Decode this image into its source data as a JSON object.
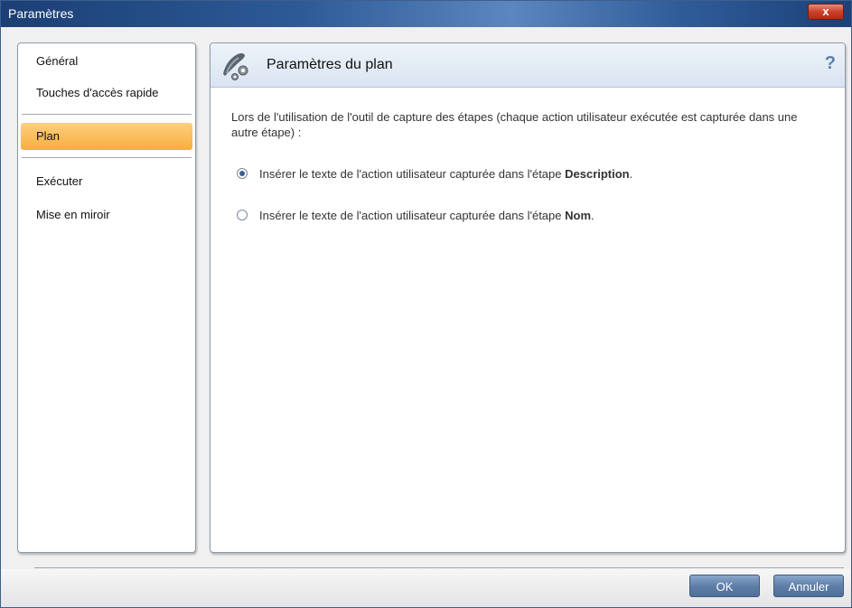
{
  "window": {
    "title": "Paramètres",
    "close_label": "x"
  },
  "sidebar": {
    "items": [
      {
        "label": "Général"
      },
      {
        "label": "Touches d'accès rapide"
      },
      {
        "label": "Plan"
      },
      {
        "label": "Exécuter"
      },
      {
        "label": "Mise en miroir"
      }
    ],
    "selected": "Plan"
  },
  "panel": {
    "title": "Paramètres du plan",
    "help_label": "?",
    "intro": "Lors de l'utilisation de l'outil de capture des étapes (chaque action utilisateur exécutée est capturée dans une autre étape) :",
    "options": [
      {
        "text": "Insérer le texte de l'action utilisateur capturée dans l'étape ",
        "emphasis": "Description",
        "suffix": ".",
        "checked": true
      },
      {
        "text": "Insérer le texte de l'action utilisateur capturée dans l'étape ",
        "emphasis": "Nom",
        "suffix": ".",
        "checked": false
      }
    ]
  },
  "footer": {
    "ok_label": "OK",
    "cancel_label": "Annuler"
  },
  "colors": {
    "accent": "#3d5f8c",
    "selected_bg": "#f7ae3d",
    "button": "#5f7fa8"
  },
  "icons": {
    "panel_icon": "plan-settings-icon",
    "help": "help-icon"
  }
}
